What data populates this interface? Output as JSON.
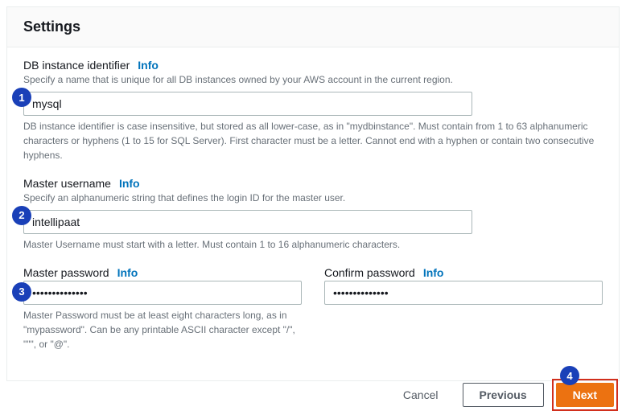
{
  "header": {
    "title": "Settings"
  },
  "db_identifier": {
    "label": "DB instance identifier",
    "info": "Info",
    "desc": "Specify a name that is unique for all DB instances owned by your AWS account in the current region.",
    "value": "mysql",
    "help": "DB instance identifier is case insensitive, but stored as all lower-case, as in \"mydbinstance\". Must contain from 1 to 63 alphanumeric characters or hyphens (1 to 15 for SQL Server). First character must be a letter. Cannot end with a hyphen or contain two consecutive hyphens."
  },
  "master_username": {
    "label": "Master username",
    "info": "Info",
    "desc": "Specify an alphanumeric string that defines the login ID for the master user.",
    "value": "intellipaat",
    "help": "Master Username must start with a letter. Must contain 1 to 16 alphanumeric characters."
  },
  "master_password": {
    "label": "Master password",
    "info": "Info",
    "value": "••••••••••••••",
    "help": "Master Password must be at least eight characters long, as in \"mypassword\". Can be any printable ASCII character except \"/\", \"\"\", or \"@\"."
  },
  "confirm_password": {
    "label": "Confirm password",
    "info": "Info",
    "value": "••••••••••••••"
  },
  "steps": {
    "s1": "1",
    "s2": "2",
    "s3": "3",
    "s4": "4"
  },
  "footer": {
    "cancel": "Cancel",
    "previous": "Previous",
    "next": "Next"
  }
}
